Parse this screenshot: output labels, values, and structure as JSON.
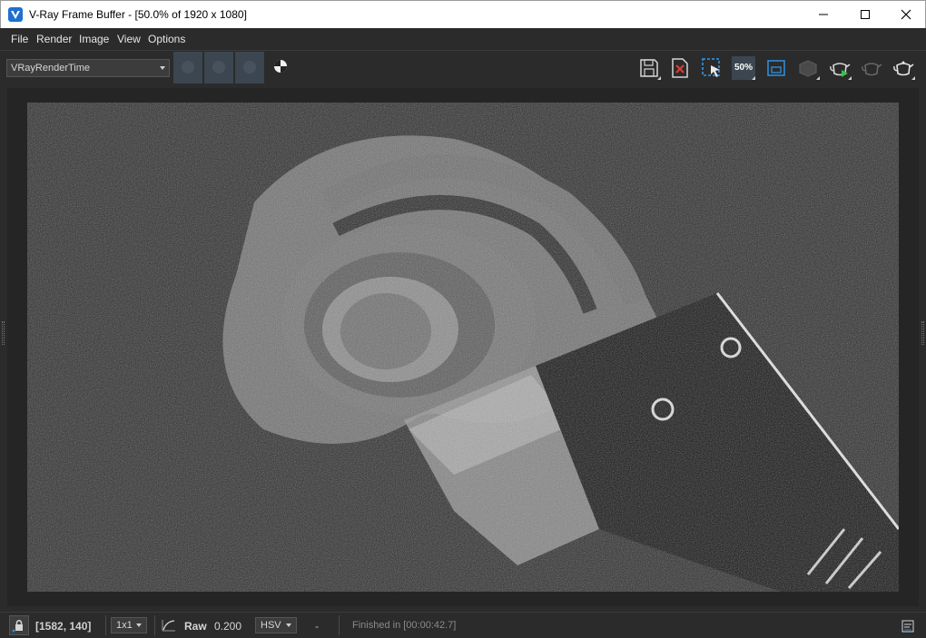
{
  "window": {
    "title": "V-Ray Frame Buffer - [50.0% of 1920 x 1080]"
  },
  "menu": {
    "items": [
      "File",
      "Render",
      "Image",
      "View",
      "Options"
    ]
  },
  "toolbar": {
    "channel": "VRayRenderTime",
    "zoom_badge": "50%",
    "icons": [
      "save-icon",
      "clear-image-icon",
      "region-render-icon",
      "zoom-icon",
      "history-icon",
      "render-element-icon",
      "start-interactive-icon",
      "stop-render-icon",
      "render-icon"
    ]
  },
  "status": {
    "coords": "[1582, 140]",
    "ratio": "1x1",
    "raw_label": "Raw",
    "raw_value": "0.200",
    "color_mode": "HSV",
    "pixel_value": "-",
    "finished": "Finished in [00:00:42.7]"
  },
  "colors": {
    "title_bg": "#ffffff",
    "panel_bg": "#2b2b2b",
    "active_btn": "#3b4650",
    "accent_blue": "#1f6fd1"
  }
}
